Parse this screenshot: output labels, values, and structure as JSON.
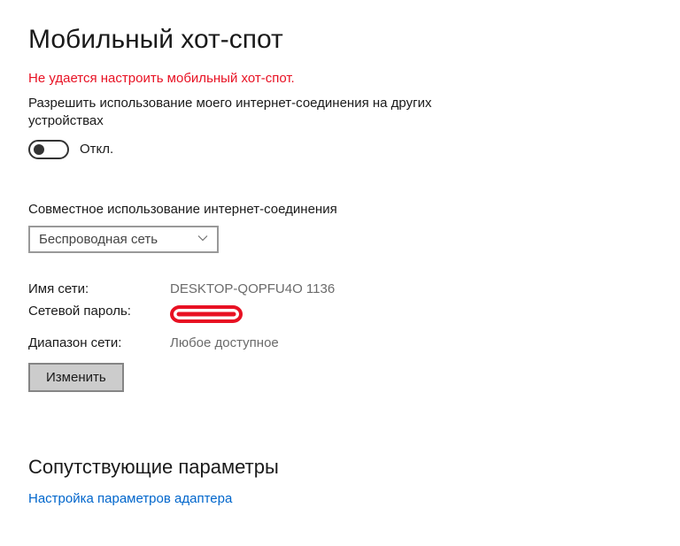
{
  "title": "Мобильный хот-спот",
  "error_message": "Не удается настроить мобильный хот-спот.",
  "share_description": "Разрешить использование моего интернет-соединения на других устройствах",
  "toggle_state_label": "Откл.",
  "share_from_label": "Совместное использование интернет-соединения",
  "share_from_selected": "Беспроводная сеть",
  "network_name_label": "Имя сети:",
  "network_name_value": "DESKTOP-QOPFU4O 1136",
  "network_password_label": "Сетевой пароль:",
  "network_password_value": "",
  "network_band_label": "Диапазон сети:",
  "network_band_value": "Любое доступное",
  "edit_button_label": "Изменить",
  "related_heading": "Сопутствующие параметры",
  "adapter_settings_link": "Настройка параметров адаптера"
}
